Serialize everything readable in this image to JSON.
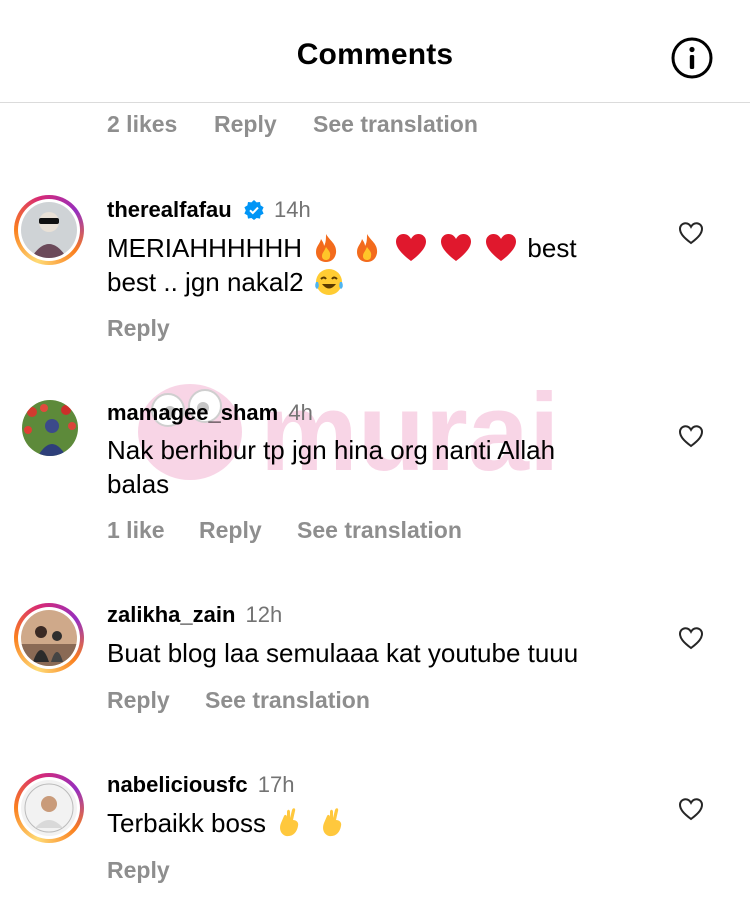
{
  "header": {
    "title": "Comments"
  },
  "top_meta": {
    "likes": "2 likes",
    "reply": "Reply",
    "translate": "See translation"
  },
  "watermark_text": "murai",
  "comments": [
    {
      "username": "therealfafau",
      "verified": true,
      "time": "14h",
      "line1_a": "MERIAHHHHHH",
      "line1_b": "best",
      "line2": "best .. jgn nakal2",
      "reply": "Reply"
    },
    {
      "username": "mamagee_sham",
      "time": "4h",
      "line1": "Nak berhibur tp jgn hina org nanti Allah",
      "line2": "balas",
      "likes": "1 like",
      "reply": "Reply",
      "translate": "See translation"
    },
    {
      "username": "zalikha_zain",
      "time": "12h",
      "line1": "Buat blog laa semulaaa kat youtube tuuu",
      "reply": "Reply",
      "translate": "See translation"
    },
    {
      "username": "nabeliciousfc",
      "time": "17h",
      "line1": "Terbaikk boss",
      "reply": "Reply"
    }
  ],
  "colors": {
    "meta_gray": "#8e8e8e",
    "verified_blue": "#0095f6",
    "divider": "#dbdbdb"
  }
}
